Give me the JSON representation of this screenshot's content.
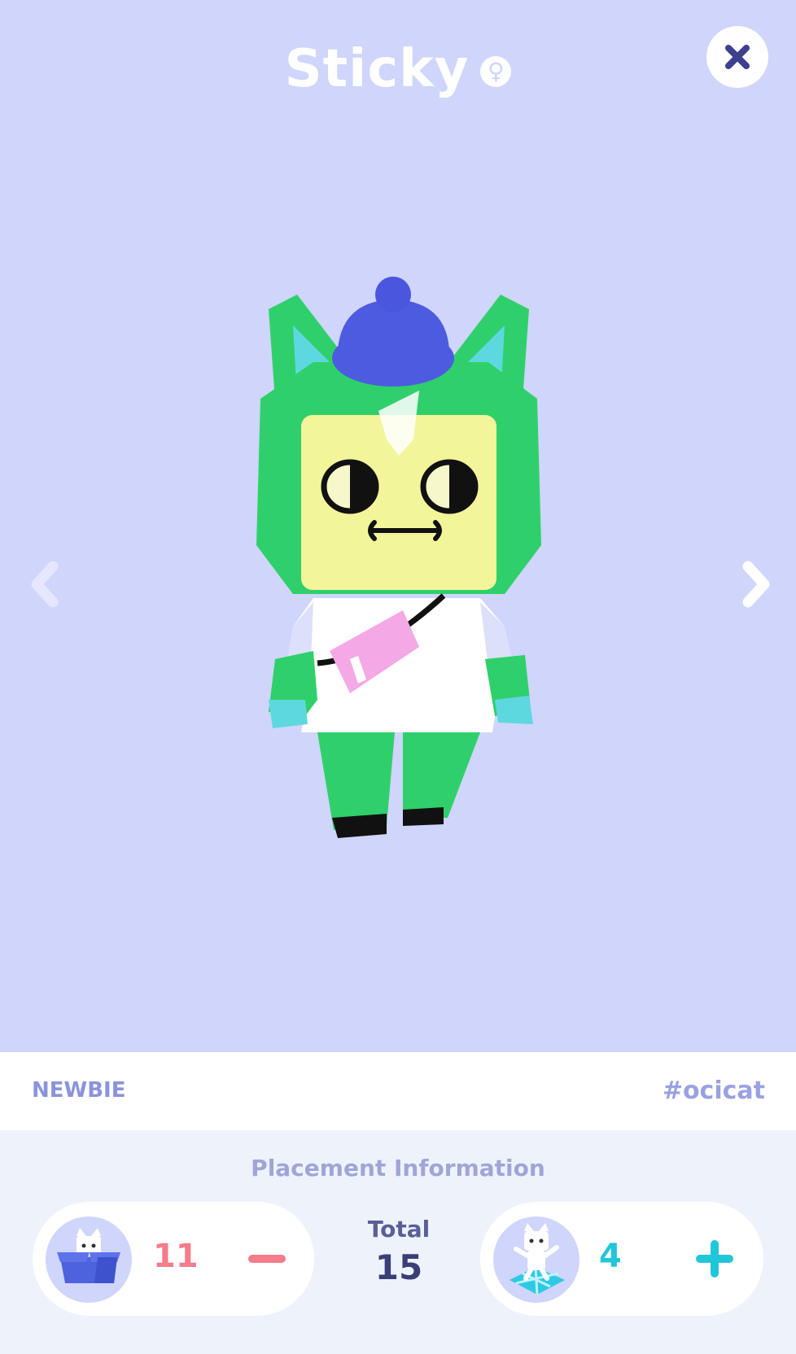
{
  "header": {
    "title": "Sticky",
    "gender_icon": "female-icon",
    "close_icon": "close-icon"
  },
  "viewer": {
    "prev_icon": "chevron-left-icon",
    "next_icon": "chevron-right-icon",
    "character_image": "green-cat-character-with-blue-beanie-and-pink-bag"
  },
  "info": {
    "rank": "NEWBIE",
    "breed": "#ocicat"
  },
  "placement": {
    "title": "Placement Information",
    "stored": {
      "icon": "cat-in-box-icon",
      "count": "11",
      "button_icon": "minus-icon"
    },
    "placed": {
      "icon": "cat-on-floor-icon",
      "count": "4",
      "button_icon": "plus-icon"
    },
    "total_label": "Total",
    "total_value": "15"
  },
  "colors": {
    "viewer_bg": "#cfd5fb",
    "close_x": "#3d3f8f",
    "minus": "#f57c8b",
    "plus": "#22c6d9",
    "panel_bg": "#eef3fb"
  }
}
